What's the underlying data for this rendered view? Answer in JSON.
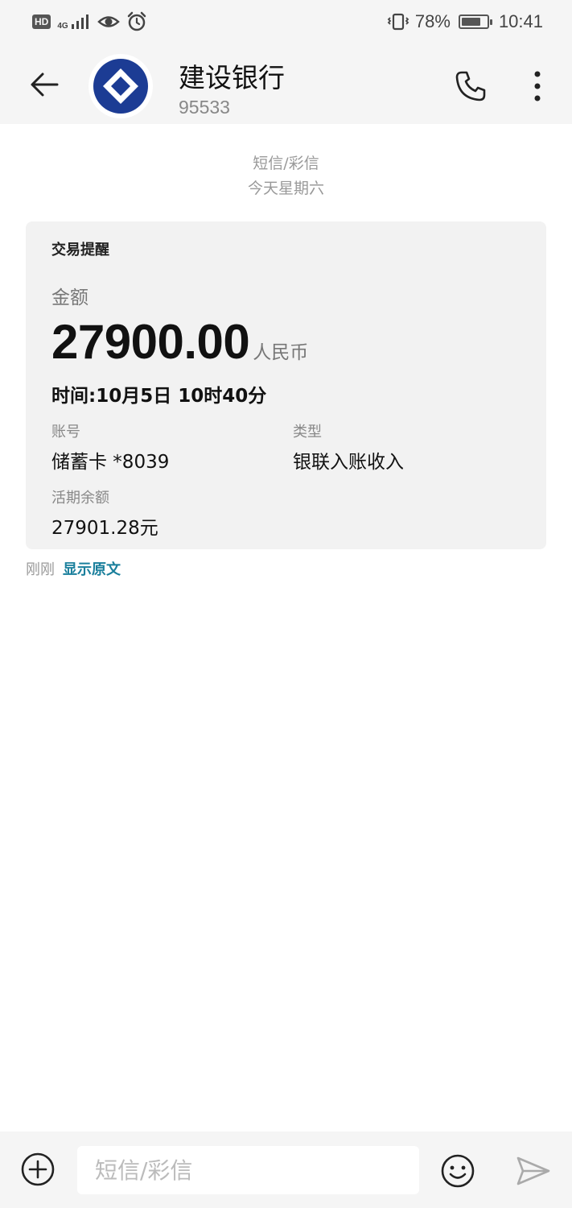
{
  "status_bar": {
    "hd": "HD",
    "network": "4G",
    "battery_percent": "78%",
    "battery_level": 0.78,
    "time": "10:41"
  },
  "header": {
    "contact_name": "建设银行",
    "contact_number": "95533",
    "icons": [
      "back-arrow-icon",
      "ccb-logo-icon",
      "phone-icon",
      "more-vertical-icon"
    ]
  },
  "conversation": {
    "message_type": "短信/彩信",
    "date": "今天星期六",
    "card": {
      "title": "交易提醒",
      "amount_label": "金额",
      "amount": "27900.00",
      "currency": "人民币",
      "time": "时间:10月5日 10时40分",
      "account_label": "账号",
      "account_value": "储蓄卡 *8039",
      "type_label": "类型",
      "type_value": "银联入账收入",
      "balance_label": "活期余额",
      "balance_value": "27901.28元"
    },
    "meta": {
      "time": "刚刚",
      "show_original": "显示原文"
    }
  },
  "compose": {
    "placeholder": "短信/彩信",
    "value": "",
    "icons": [
      "add-circle-icon",
      "emoji-icon",
      "send-icon"
    ]
  },
  "colors": {
    "link": "#1a7f9c",
    "ccb_blue": "#1c3c94",
    "card_bg": "#f2f2f2"
  }
}
